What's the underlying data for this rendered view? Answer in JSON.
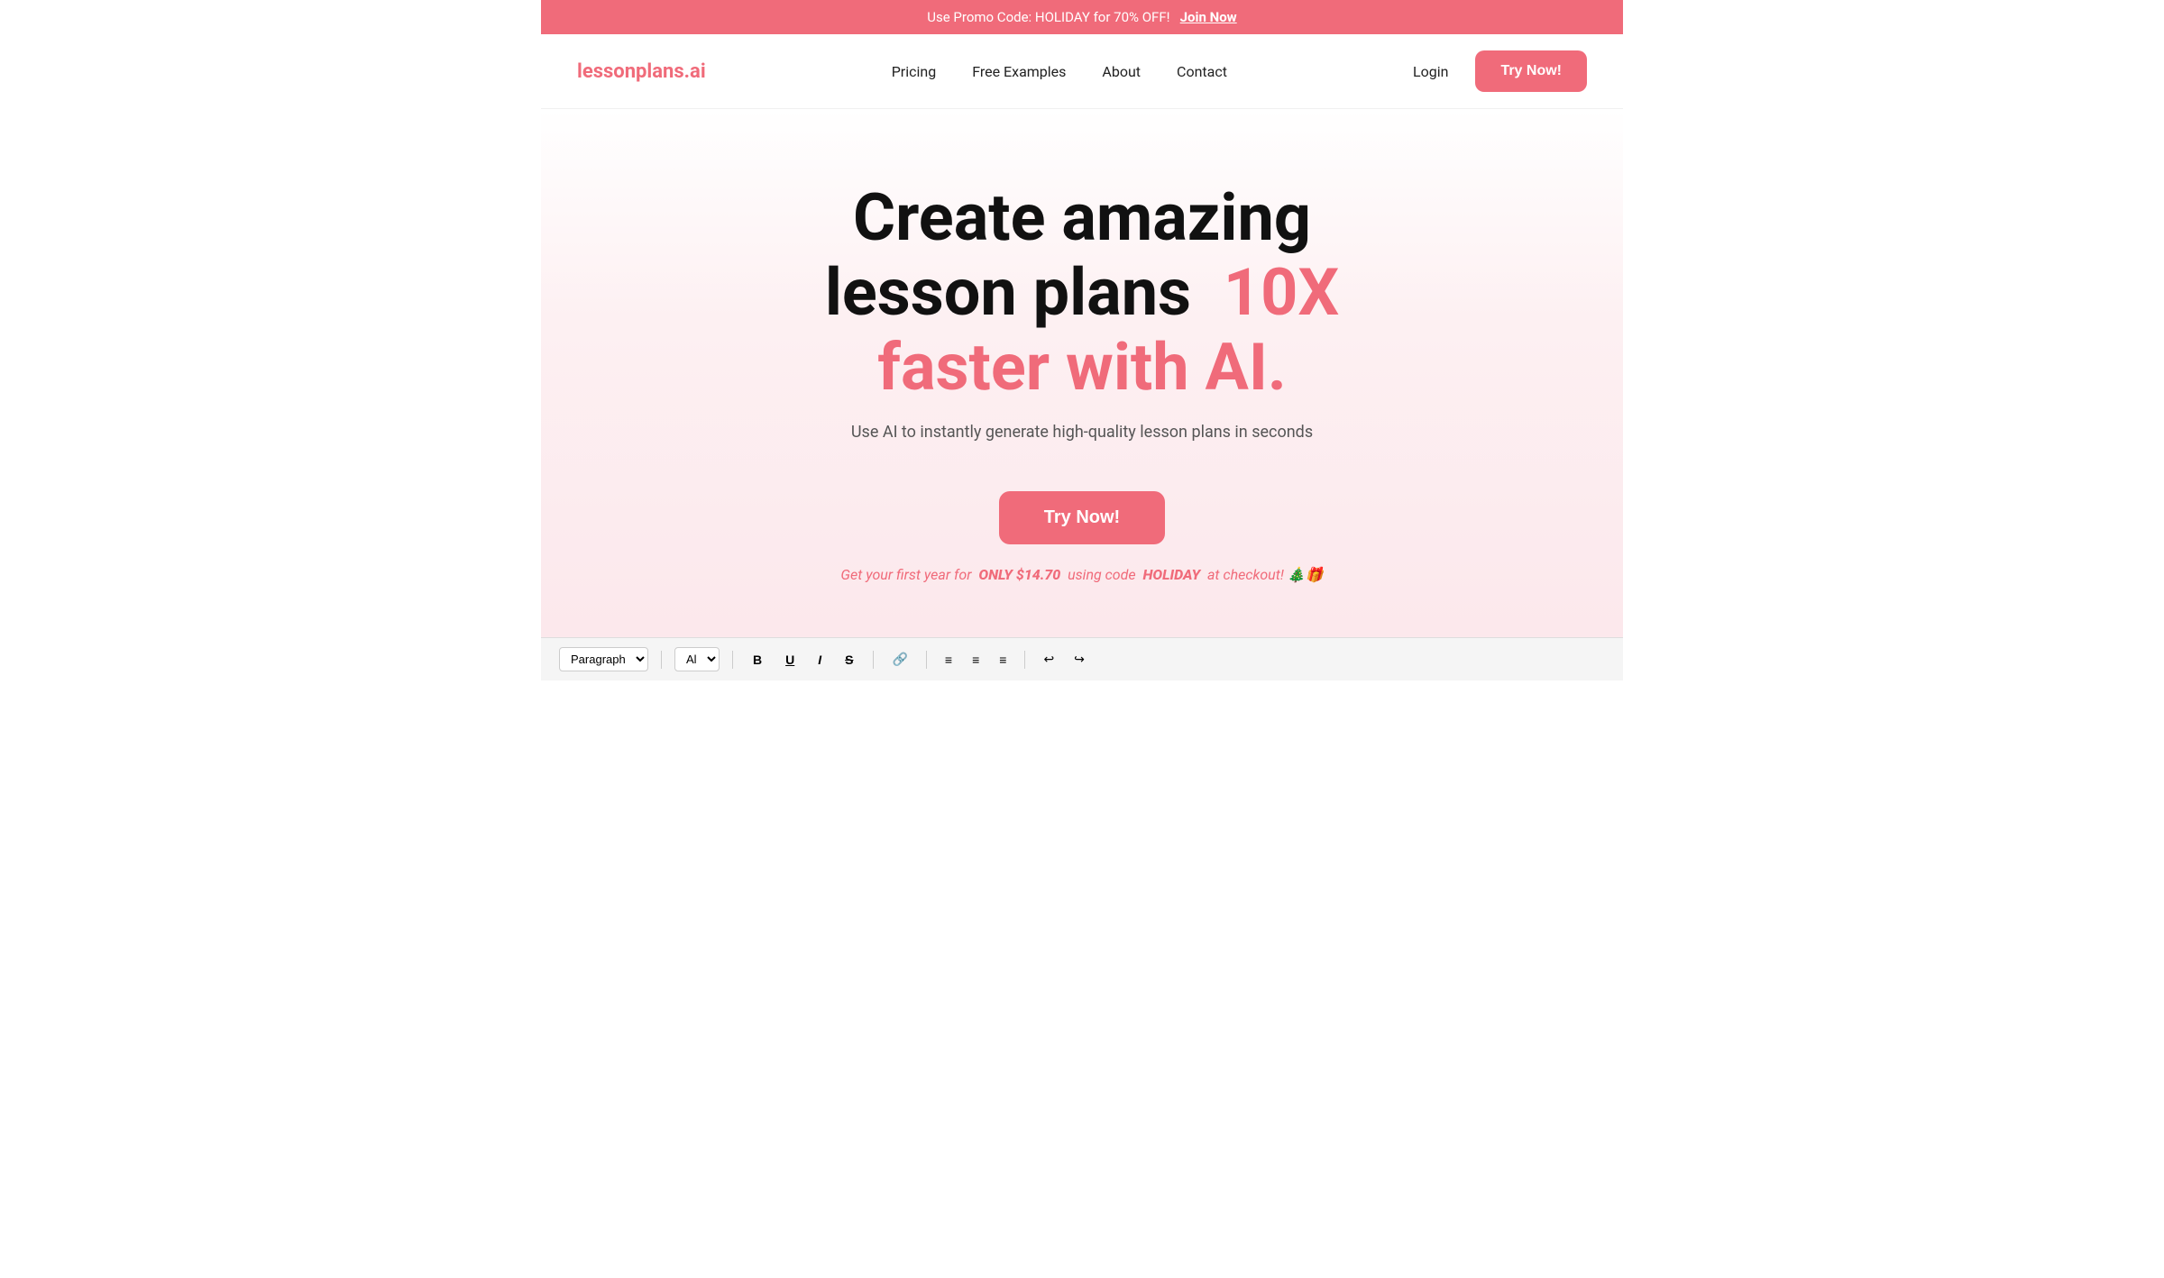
{
  "promo_banner": {
    "text": "Use Promo Code: HOLIDAY for 70% OFF!",
    "link_text": "Join Now",
    "bg_color": "#f06b7a"
  },
  "header": {
    "logo_text": "lessonplans",
    "logo_suffix": ".ai",
    "nav_items": [
      {
        "label": "Pricing",
        "href": "#"
      },
      {
        "label": "Free Examples",
        "href": "#"
      },
      {
        "label": "About",
        "href": "#"
      },
      {
        "label": "Contact",
        "href": "#"
      }
    ],
    "login_label": "Login",
    "try_now_label": "Try Now!"
  },
  "hero": {
    "title_line1": "Create amazing",
    "title_line2": "lesson plans",
    "title_highlight": "10X",
    "title_line3": "faster with AI.",
    "subtitle": "Use AI to instantly generate high-quality lesson plans in seconds",
    "cta_label": "Try Now!",
    "promo_text_prefix": "Get your first year for",
    "promo_text_amount": "ONLY $14.70",
    "promo_text_middle": "using code",
    "promo_text_code": "HOLIDAY",
    "promo_text_suffix": "at checkout! 🎄🎁"
  },
  "toolbar": {
    "paragraph_label": "Paragraph",
    "font_label": "Al",
    "bold": "B",
    "italic": "I",
    "underline": "U",
    "strikethrough": "S",
    "link_icon": "🔗",
    "list_unordered": "≡",
    "list_ordered": "≡",
    "indent": "≡",
    "undo": "↩",
    "redo": "↪"
  }
}
